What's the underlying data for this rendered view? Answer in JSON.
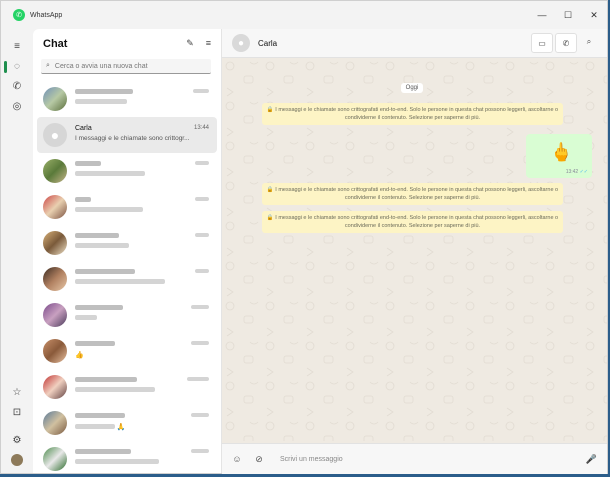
{
  "app": {
    "title": "WhatsApp",
    "logo_glyph": "✆"
  },
  "window_controls": {
    "minimize": "—",
    "maximize": "☐",
    "close": "✕"
  },
  "rail": {
    "icons": [
      "menu-icon",
      "chats-icon",
      "calls-icon",
      "status-icon",
      "starred-icon",
      "archive-icon",
      "settings-icon",
      "profile-icon"
    ],
    "glyphs": {
      "menu": "≡",
      "chats": "◌",
      "calls": "✆",
      "status": "◎",
      "starred": "☆",
      "archive": "⊡",
      "settings": "⚙"
    }
  },
  "chat_list": {
    "header": "Chat",
    "new_chat_glyph": "✎",
    "filter_glyph": "≡",
    "search_placeholder": "Cerca o avvia una nuova chat",
    "search_glyph": "⌕",
    "selected": {
      "name": "Carla",
      "time": "13:44",
      "preview": "I messaggi e le chiamate sono crittogr..."
    }
  },
  "conversation": {
    "contact_name": "Carla",
    "date_label": "Oggi",
    "notice_text": "I messaggi e le chiamate sono crittografati end-to-end. Solo le persone in questa chat possono leggerli, ascoltarne o condividerne il contenuto. Selezione per saperne di più.",
    "sent_time": "13:42",
    "sent_ticks": "✓✓",
    "sent_emoji": "🖕",
    "composer_placeholder": "Scrivi un messaggio",
    "header_buttons": {
      "video": "▭",
      "call": "✆",
      "search": "⌕"
    },
    "composer_icons": {
      "emoji": "☺",
      "attach": "⊘",
      "mic": "🎤"
    }
  },
  "colors": {
    "accent": "#1f8f4e",
    "notice_bg": "#fdf4c5",
    "sent_bg": "#d9fdd3",
    "chat_bg": "#efeae2"
  }
}
